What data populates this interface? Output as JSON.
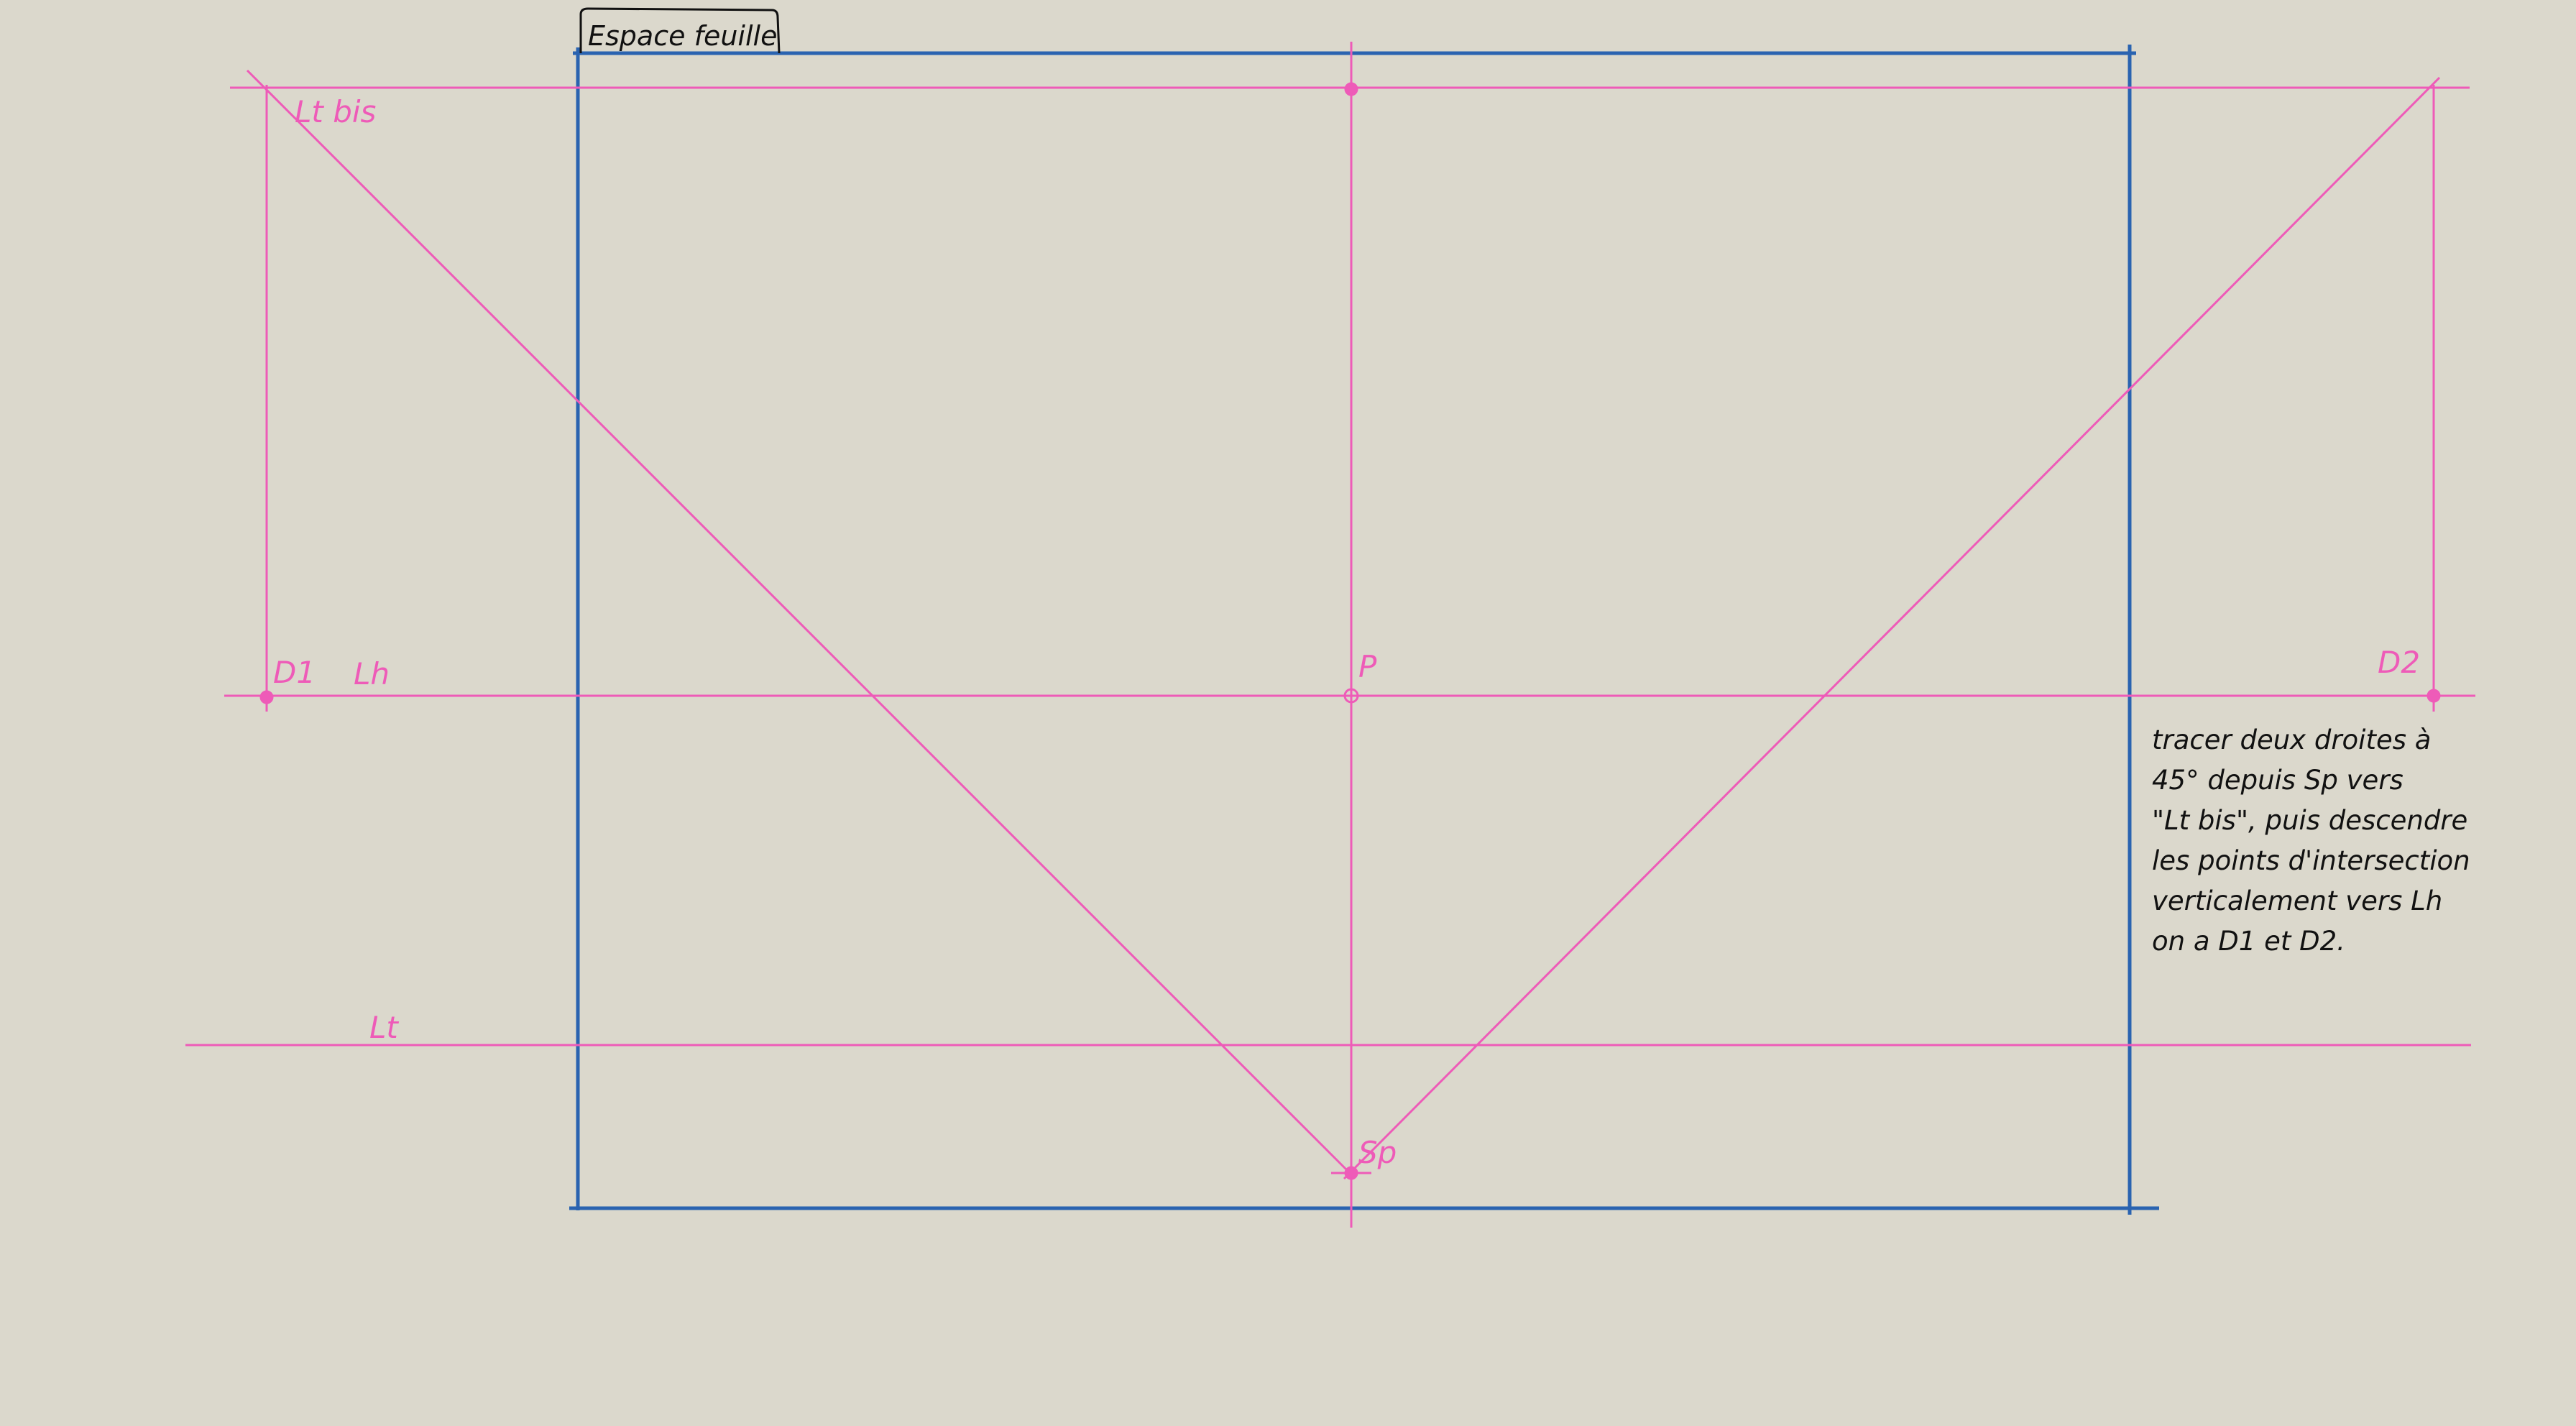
{
  "sheet": {
    "label": "Espace feuille"
  },
  "labels": {
    "lt_bis": "Lt bis",
    "d1": "D1",
    "lh": "Lh",
    "p": "P",
    "d2": "D2",
    "lt": "Lt",
    "sp": "Sp"
  },
  "note": {
    "lines": [
      "tracer deux droites à",
      "45° depuis Sp vers",
      "\"Lt bis\", puis descendre",
      "les points d'intersection",
      "verticalement vers Lh",
      "on a D1 et D2."
    ]
  },
  "colors": {
    "background": "#dbd8cc",
    "construction": "#ee5bb8",
    "sheet_frame": "#2a63b0",
    "ink": "#111111"
  }
}
